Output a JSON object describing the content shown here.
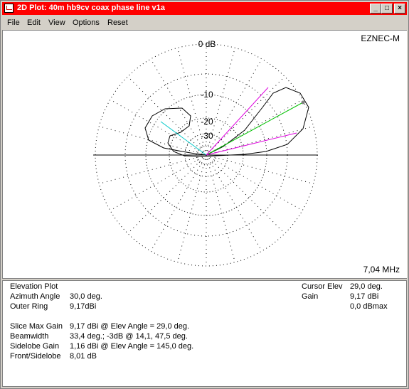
{
  "window": {
    "title": "2D Plot: 40m hb9cv coax phase line  v1a"
  },
  "titlebar_buttons": {
    "minimize": "_",
    "maximize": "□",
    "close": "×"
  },
  "menu": [
    "File",
    "Edit",
    "View",
    "Options",
    "Reset"
  ],
  "plot": {
    "program": "EZNEC-M",
    "frequency": "7,04 MHz",
    "ring_labels": [
      "0 dB",
      "-10",
      "-20",
      "-30"
    ],
    "colors": {
      "pattern": "#000000",
      "cursor": "#00c000",
      "beamwidth": "#e000e0",
      "sidelobe": "#00c8c8",
      "grid": "#000000"
    }
  },
  "info": {
    "plot_type": "Elevation Plot",
    "azimuth_label": "Azimuth Angle",
    "azimuth_value": "30,0 deg.",
    "outer_ring_label": "Outer Ring",
    "outer_ring_value": "9,17dBi",
    "slice_max_label": "Slice Max Gain",
    "slice_max_value": "9,17 dBi @ Elev Angle = 29,0 deg.",
    "beamwidth_label": "Beamwidth",
    "beamwidth_value": "33,4 deg.; -3dB @ 14,1, 47,5 deg.",
    "sidelobe_label": "Sidelobe Gain",
    "sidelobe_value": "1,16 dBi @ Elev Angle = 145,0 deg.",
    "fs_label": "Front/Sidelobe",
    "fs_value": "8,01 dB",
    "cursor_elev_label": "Cursor Elev",
    "cursor_elev_value": "29,0 deg.",
    "gain_label": "Gain",
    "gain_value": "9,17 dBi",
    "gain_max_value": "0,0 dBmax"
  }
}
